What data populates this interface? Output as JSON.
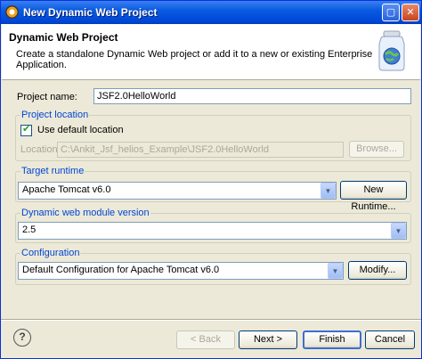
{
  "window": {
    "title": "New Dynamic Web Project"
  },
  "header": {
    "title": "Dynamic Web Project",
    "description": "Create a standalone Dynamic Web project or add it to a new or existing Enterprise Application."
  },
  "project_name": {
    "label": "Project name:",
    "value": "JSF2.0HelloWorld"
  },
  "project_location": {
    "group_label": "Project location",
    "use_default_label": "Use default location",
    "use_default_checked": true,
    "location_label": "Location:",
    "location_value": "C:\\Ankit_Jsf_helios_Example\\JSF2.0HelloWorld",
    "browse_label": "Browse..."
  },
  "target_runtime": {
    "group_label": "Target runtime",
    "selected": "Apache Tomcat v6.0",
    "new_runtime_label": "New Runtime..."
  },
  "module_version": {
    "group_label": "Dynamic web module version",
    "selected": "2.5"
  },
  "configuration": {
    "group_label": "Configuration",
    "selected": "Default Configuration for Apache Tomcat v6.0",
    "modify_label": "Modify..."
  },
  "footer": {
    "help_glyph": "?",
    "back_label": "< Back",
    "next_label": "Next >",
    "finish_label": "Finish",
    "cancel_label": "Cancel"
  },
  "icons": {
    "window_icon": "eclipse-icon",
    "header_icon": "web-project-jar-icon",
    "help_icon": "help-icon",
    "dropdown_icon": "chevron-down-icon"
  }
}
